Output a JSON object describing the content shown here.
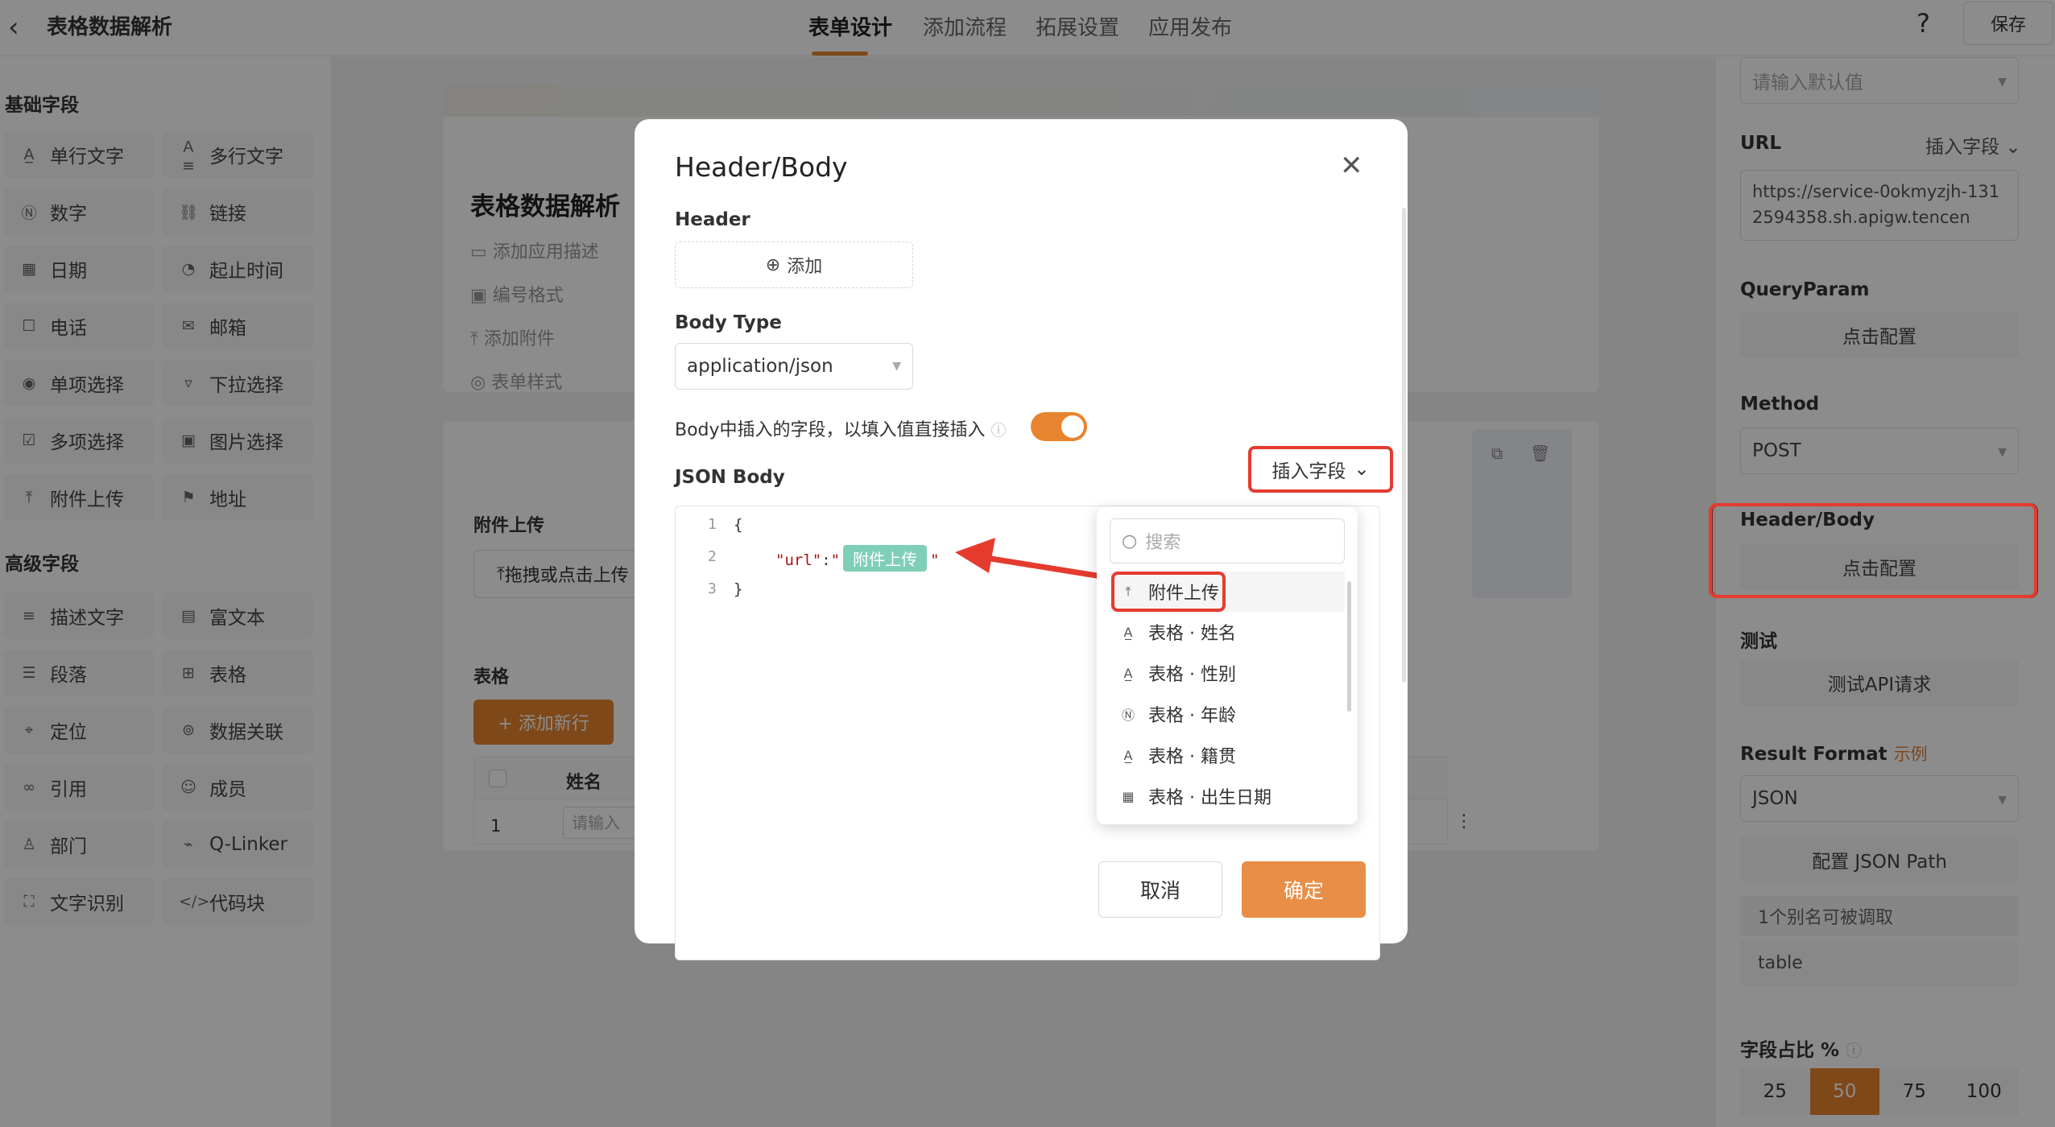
{
  "header": {
    "back_icon": "chevron-left-icon",
    "title": "表格数据解析",
    "tabs": [
      "表单设计",
      "添加流程",
      "拓展设置",
      "应用发布"
    ],
    "active_tab": "表单设计",
    "help": "?",
    "save": "保存"
  },
  "left": {
    "basic_title": "基础字段",
    "basic": [
      {
        "label": "单行文字",
        "icon": "text-icon"
      },
      {
        "label": "多行文字",
        "icon": "multiline-text-icon"
      },
      {
        "label": "数字",
        "icon": "number-icon"
      },
      {
        "label": "链接",
        "icon": "link-icon"
      },
      {
        "label": "日期",
        "icon": "calendar-icon"
      },
      {
        "label": "起止时间",
        "icon": "time-range-icon"
      },
      {
        "label": "电话",
        "icon": "phone-icon"
      },
      {
        "label": "邮箱",
        "icon": "mail-icon"
      },
      {
        "label": "单项选择",
        "icon": "radio-icon"
      },
      {
        "label": "下拉选择",
        "icon": "dropdown-icon"
      },
      {
        "label": "多项选择",
        "icon": "checkbox-icon"
      },
      {
        "label": "图片选择",
        "icon": "image-icon"
      },
      {
        "label": "附件上传",
        "icon": "upload-icon"
      },
      {
        "label": "地址",
        "icon": "location-icon"
      }
    ],
    "advanced_title": "高级字段",
    "advanced": [
      {
        "label": "描述文字",
        "icon": "description-icon"
      },
      {
        "label": "富文本",
        "icon": "rich-text-icon"
      },
      {
        "label": "段落",
        "icon": "paragraph-icon"
      },
      {
        "label": "表格",
        "icon": "table-icon"
      },
      {
        "label": "定位",
        "icon": "pin-icon"
      },
      {
        "label": "数据关联",
        "icon": "data-link-icon"
      },
      {
        "label": "引用",
        "icon": "reference-icon"
      },
      {
        "label": "成员",
        "icon": "user-icon"
      },
      {
        "label": "部门",
        "icon": "department-icon"
      },
      {
        "label": "Q-Linker",
        "icon": "qlinker-icon"
      },
      {
        "label": "文字识别",
        "icon": "ocr-icon"
      },
      {
        "label": "代码块",
        "icon": "code-icon"
      }
    ]
  },
  "canvas": {
    "form_title": "表格数据解析",
    "meta": [
      "添加应用描述",
      "编号格式",
      "添加附件",
      "表单样式"
    ],
    "attachment_label": "附件上传",
    "attachment_btn": "拖拽或点击上传",
    "table_label": "表格",
    "add_row": "+ 添加新行",
    "col_name": "姓名",
    "row_index": "1",
    "row_placeholder": "请输入"
  },
  "right": {
    "default_placeholder": "请输入默认值",
    "url_label": "URL",
    "insert_field": "插入字段",
    "url_value": "https://service-0okmyzjh-1312594358.sh.apigw.tencen",
    "query_label": "QueryParam",
    "click_config": "点击配置",
    "method_label": "Method",
    "method_value": "POST",
    "hb_label": "Header/Body",
    "test_label": "测试",
    "test_btn": "测试API请求",
    "result_label": "Result Format",
    "result_example": "示例",
    "result_value": "JSON",
    "json_path_btn": "配置 JSON Path",
    "alias_text": "1个别名可被调取",
    "alias_value": "table",
    "ratio_label": "字段占比 %",
    "ratios": [
      "25",
      "50",
      "75",
      "100"
    ],
    "ratio_selected": "50",
    "accent_color": "#e8842f"
  },
  "modal": {
    "title": "Header/Body",
    "header_label": "Header",
    "add_btn": "添加",
    "body_type_label": "Body Type",
    "body_type_value": "application/json",
    "insert_hint": "Body中插入的字段，以填入值直接插入",
    "toggle_on": true,
    "json_body_label": "JSON Body",
    "insert_field_btn": "插入字段",
    "code": {
      "line_numbers": [
        "1",
        "2",
        "3"
      ],
      "line1": "{",
      "key": "\"url\"",
      "colon": ":",
      "quote": "\"",
      "chip": "附件上传",
      "line3": "}"
    },
    "dropdown": {
      "search_placeholder": "搜索",
      "items": [
        {
          "label": "附件上传",
          "icon": "upload-icon"
        },
        {
          "label": "表格 · 姓名",
          "icon": "text-icon"
        },
        {
          "label": "表格 · 性别",
          "icon": "text-icon"
        },
        {
          "label": "表格 · 年龄",
          "icon": "number-icon"
        },
        {
          "label": "表格 · 籍贯",
          "icon": "text-icon"
        },
        {
          "label": "表格 · 出生日期",
          "icon": "calendar-icon"
        }
      ]
    },
    "cancel": "取消",
    "ok": "确定",
    "highlight_color": "#e53b2f"
  }
}
